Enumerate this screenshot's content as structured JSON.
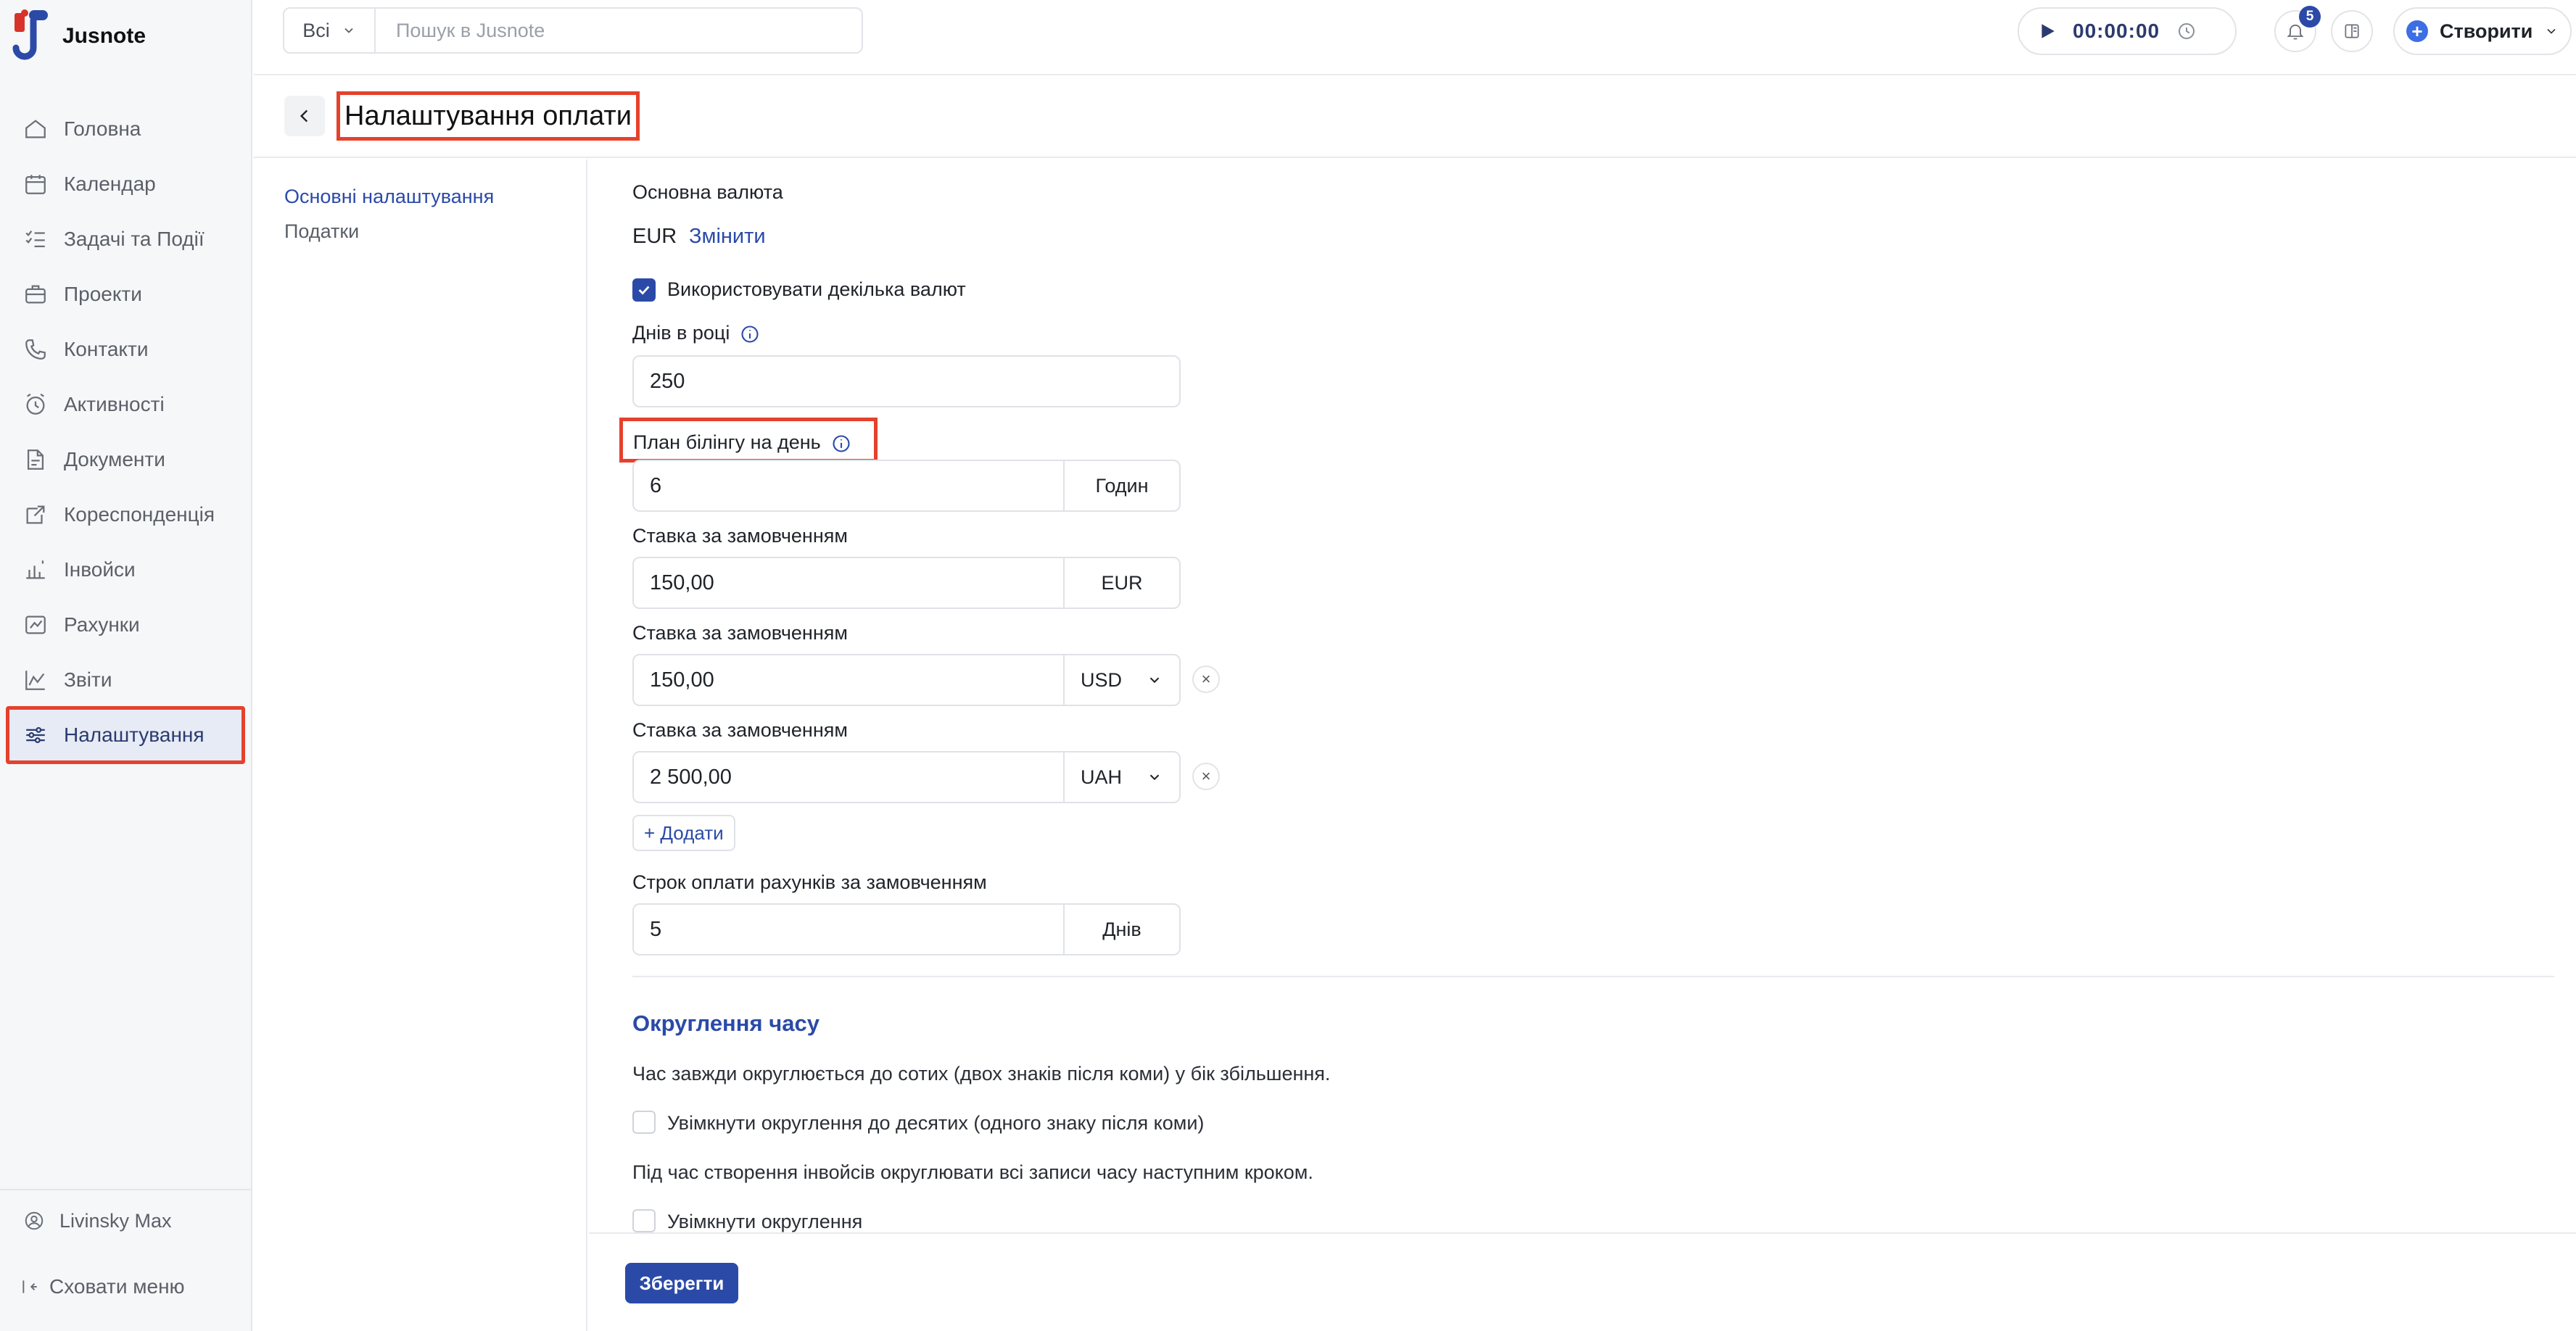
{
  "app": {
    "name": "Jusnote"
  },
  "sidebar": {
    "items": [
      {
        "label": "Головна",
        "icon": "home-icon"
      },
      {
        "label": "Календар",
        "icon": "calendar-icon"
      },
      {
        "label": "Задачі та Події",
        "icon": "tasks-icon"
      },
      {
        "label": "Проекти",
        "icon": "briefcase-icon"
      },
      {
        "label": "Контакти",
        "icon": "contacts-icon"
      },
      {
        "label": "Активності",
        "icon": "clock-icon"
      },
      {
        "label": "Документи",
        "icon": "documents-icon"
      },
      {
        "label": "Кореспонденція",
        "icon": "correspondence-icon"
      },
      {
        "label": "Інвойси",
        "icon": "invoices-icon"
      },
      {
        "label": "Рахунки",
        "icon": "accounts-icon"
      },
      {
        "label": "Звіти",
        "icon": "reports-icon"
      },
      {
        "label": "Налаштування",
        "icon": "sliders-icon",
        "active": true
      }
    ],
    "user": "Livinsky Max",
    "hide_menu": "Сховати меню"
  },
  "topbar": {
    "search_scope": "Всі",
    "search_placeholder": "Пошук в Jusnote",
    "timer": "00:00:00",
    "notifications_count": "5",
    "create_label": "Створити"
  },
  "page": {
    "title": "Налаштування оплати",
    "subnav": [
      "Основні налаштування",
      "Податки"
    ]
  },
  "form": {
    "base_currency_label": "Основна валюта",
    "base_currency_value": "EUR",
    "change_link": "Змінити",
    "multi_currency_label": "Використовувати декілька валют",
    "multi_currency_checked": true,
    "days_label": "Днів в році",
    "days_value": "250",
    "billing_plan_label": "План білінгу на день",
    "billing_plan_value": "6",
    "billing_plan_unit": "Годин",
    "rates": [
      {
        "label": "Ставка за замовченням",
        "value": "150,00",
        "currency": "EUR",
        "removable": false
      },
      {
        "label": "Ставка за замовченням",
        "value": "150,00",
        "currency": "USD",
        "removable": true
      },
      {
        "label": "Ставка за замовченням",
        "value": "2 500,00",
        "currency": "UAH",
        "removable": true
      }
    ],
    "add_label": "+ Додати",
    "due_label": "Строк оплати рахунків за замовченням",
    "due_value": "5",
    "due_unit": "Днів",
    "rounding": {
      "title": "Округлення часу",
      "description": "Час завжди округлюється до сотих (двох знаків після коми) у бік збільшення.",
      "tenths_label": "Увімкнути округлення до десятих (одного знаку після коми)",
      "tenths_checked": false,
      "invoice_description": "Під час створення інвойсів округлювати всі записи часу наступним кроком.",
      "enable_label": "Увімкнути округлення",
      "enable_checked": false
    },
    "save_label": "Зберегти"
  },
  "colors": {
    "accent": "#2b4aa8",
    "highlight": "#e5412d",
    "sidebar_bg": "#f6f7f9"
  }
}
